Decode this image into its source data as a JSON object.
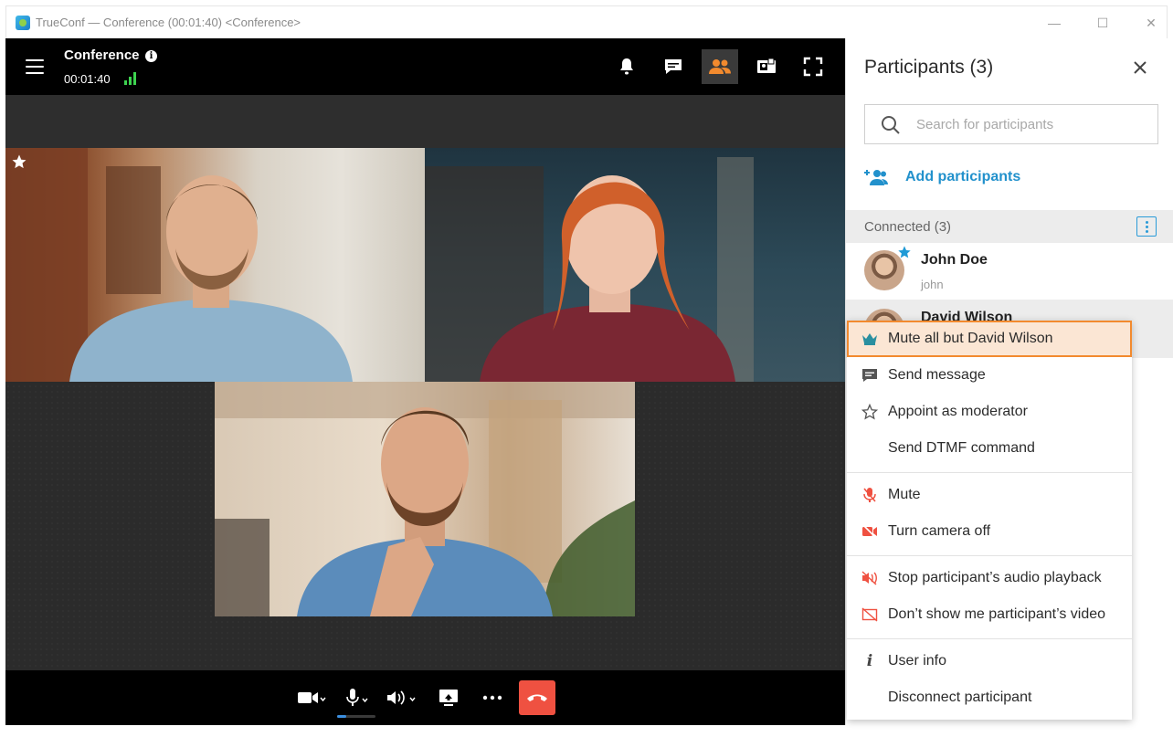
{
  "window": {
    "title": "TrueConf — Conference (00:01:40) <Conference>",
    "controls": [
      "—",
      "☐",
      "✕"
    ]
  },
  "conference": {
    "name": "Conference",
    "elapsed": "00:01:40",
    "accent": "#f28a2e",
    "topbar_buttons": [
      "bell-icon",
      "chat-icon",
      "participants-icon",
      "content-icon",
      "fullscreen-icon"
    ],
    "active_button": "participants-icon"
  },
  "video_tiles": [
    "video-tile-john-doe",
    "video-tile-female-participant",
    "video-tile-david-wilson"
  ],
  "bottom_controls": [
    "camera-icon",
    "microphone-icon",
    "speaker-icon",
    "share-screen-icon",
    "more-icon",
    "end-call-icon"
  ],
  "panel": {
    "title": "Participants (3)",
    "search_placeholder": "Search for participants",
    "add_label": "Add participants",
    "group_label": "Connected (3)",
    "participants": [
      {
        "name": "John Doe",
        "login": "john",
        "owner": true
      },
      {
        "name": "David Wilson",
        "login": "",
        "owner": false
      }
    ]
  },
  "context_menu": {
    "items": [
      {
        "label": "Mute all but David Wilson",
        "icon": "crown-icon",
        "highlighted": true
      },
      {
        "label": "Send message",
        "icon": "message-icon"
      },
      {
        "label": "Appoint as moderator",
        "icon": "star-outline-icon"
      },
      {
        "label": "Send DTMF command",
        "icon": ""
      },
      {
        "label": "Mute",
        "icon": "mic-off-icon"
      },
      {
        "label": "Turn camera off",
        "icon": "camera-off-icon"
      },
      {
        "label": "Stop participant’s audio playback",
        "icon": "speaker-off-icon"
      },
      {
        "label": "Don’t show me participant’s video",
        "icon": "video-hide-icon"
      },
      {
        "label": "User info",
        "icon": "info-italic-icon"
      },
      {
        "label": "Disconnect participant",
        "icon": ""
      }
    ]
  },
  "colors": {
    "link_blue": "#2291cc",
    "end_call_red": "#ef5141",
    "signal_green": "#3dd24f"
  }
}
